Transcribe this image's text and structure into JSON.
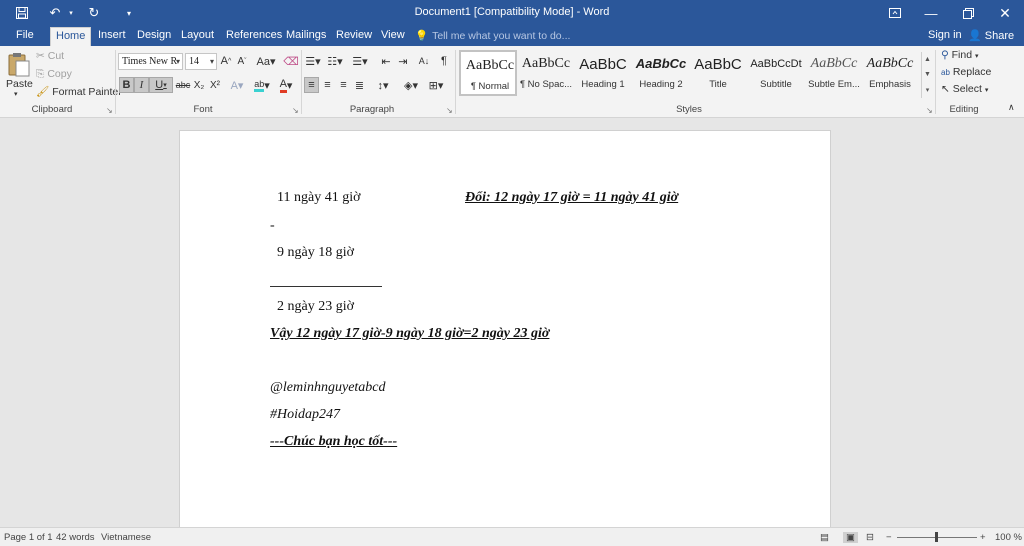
{
  "titlebar": {
    "title": "Document1 [Compatibility Mode] - Word",
    "save_icon": "save-icon",
    "undo_icon": "undo-icon",
    "redo_icon": "redo-icon",
    "customize_icon": "customize-qat-icon",
    "window_buttons": [
      "ribbon-display-icon",
      "minimize-icon",
      "restore-icon",
      "close-icon"
    ]
  },
  "tabs": [
    "File",
    "Home",
    "Insert",
    "Design",
    "Layout",
    "References",
    "Mailings",
    "Review",
    "View"
  ],
  "active_tab": "Home",
  "tellme": {
    "placeholder": "Tell me what you want to do..."
  },
  "account": {
    "signin": "Sign in",
    "share": "Share"
  },
  "clipboard": {
    "paste": "Paste",
    "cut": "Cut",
    "copy": "Copy",
    "format_painter": "Format Painter",
    "label": "Clipboard"
  },
  "font": {
    "name": "Times New R",
    "size": "14",
    "label": "Font",
    "bold": "B",
    "italic": "I",
    "underline": "U",
    "strike": "abc",
    "sub": "X₂",
    "sup": "X²"
  },
  "paragraph": {
    "label": "Paragraph"
  },
  "styles": {
    "label": "Styles",
    "items": [
      {
        "sample": "AaBbCc",
        "name": "¶ Normal"
      },
      {
        "sample": "AaBbCc",
        "name": "¶ No Spac..."
      },
      {
        "sample": "AaBbC",
        "name": "Heading 1"
      },
      {
        "sample": "AaBbCc",
        "name": "Heading 2"
      },
      {
        "sample": "AaBbC",
        "name": "Title"
      },
      {
        "sample": "AaBbCcDt",
        "name": "Subtitle"
      },
      {
        "sample": "AaBbCc",
        "name": "Subtle Em..."
      },
      {
        "sample": "AaBbCc",
        "name": "Emphasis"
      }
    ]
  },
  "editing": {
    "label": "Editing",
    "find": "Find",
    "replace": "Replace",
    "select": "Select"
  },
  "document": {
    "line1": "11 ngày 41 giờ",
    "note": "Đổi: 12 ngày 17 giờ = 11 ngày 41 giờ",
    "minus": "-",
    "line2": "9 ngày   18 giờ",
    "line3": "2 ngày  23 giờ",
    "conclusion": "Vậy 12 ngày 17 giờ-9 ngày 18 giờ=2 ngày 23 giờ",
    "handle": "@leminhnguyetabcd",
    "hashtag": "#Hoidap247",
    "closing": "---Chúc bạn học tốt---"
  },
  "status": {
    "page": "Page 1 of 1",
    "words": "42 words",
    "language": "Vietnamese",
    "zoom": "100 %"
  }
}
